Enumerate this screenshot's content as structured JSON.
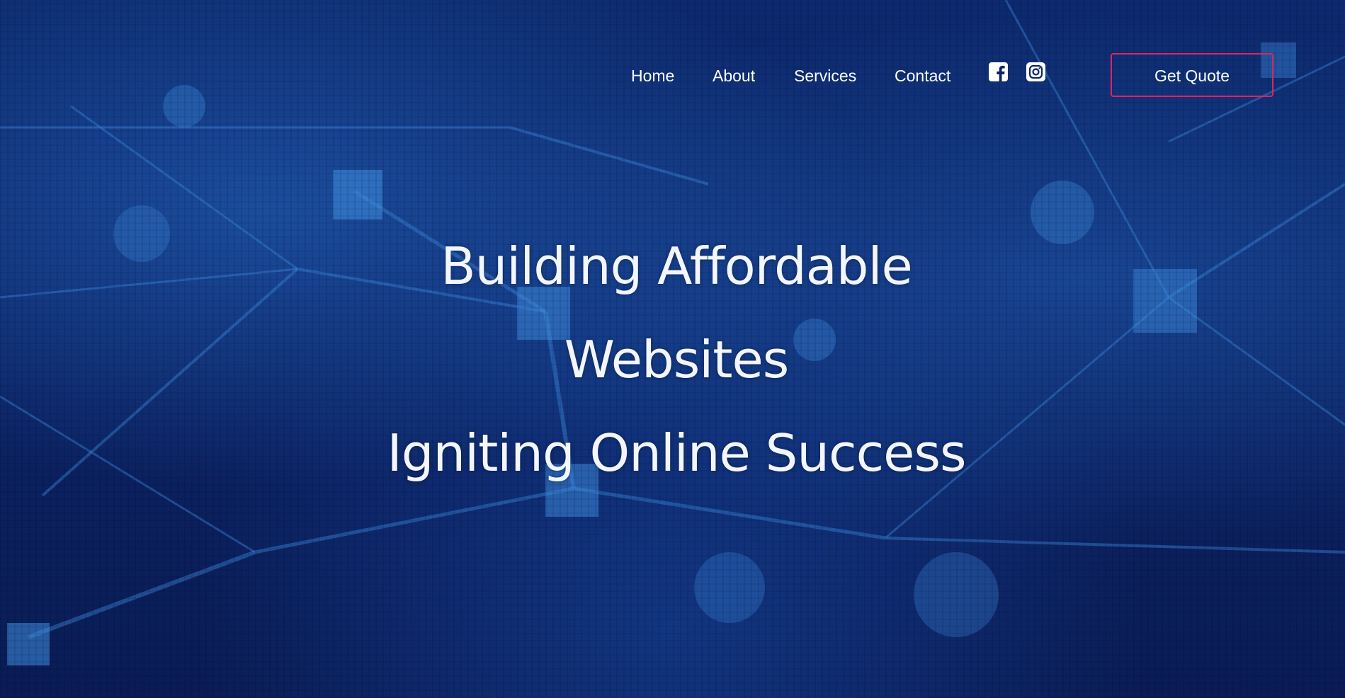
{
  "nav": {
    "links": [
      {
        "label": "Home"
      },
      {
        "label": "About"
      },
      {
        "label": "Services"
      },
      {
        "label": "Contact"
      }
    ],
    "social": [
      {
        "icon": "facebook-icon"
      },
      {
        "icon": "instagram-icon"
      }
    ],
    "cta_label": "Get Quote"
  },
  "hero": {
    "line1": "Building Affordable",
    "line2": "Websites",
    "line3": "Igniting Online Success"
  },
  "colors": {
    "background": "#0c2466",
    "accent_border": "#e0245e",
    "text": "#ffffff"
  }
}
